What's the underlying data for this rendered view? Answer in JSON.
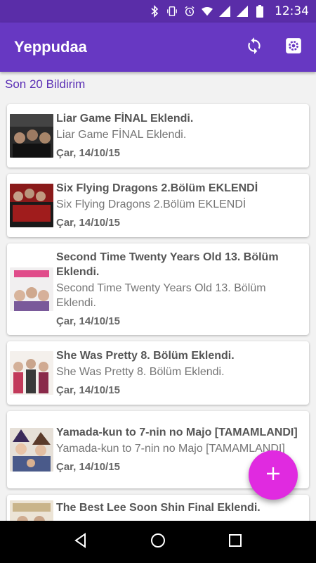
{
  "status_bar": {
    "time": "12:34",
    "icons": [
      "bluetooth-icon",
      "vibrate-icon",
      "alarm-icon",
      "wifi-icon",
      "signal-icon",
      "signal-icon",
      "battery-icon"
    ]
  },
  "app_bar": {
    "title": "Yeppudaa",
    "actions": [
      "refresh-icon",
      "settings-icon"
    ]
  },
  "section_title": "Son 20 Bildirim",
  "notifications": [
    {
      "title": "Liar Game FİNAL Eklendi.",
      "subtitle": "Liar Game FİNAL Eklendi.",
      "date": "Çar, 14/10/15"
    },
    {
      "title": "Six Flying Dragons 2.Bölüm EKLENDİ",
      "subtitle": "Six Flying Dragons 2.Bölüm EKLENDİ",
      "date": "Çar, 14/10/15"
    },
    {
      "title": "Second Time Twenty Years Old 13. Bölüm Eklendi.",
      "subtitle": "Second Time Twenty Years Old 13. Bölüm Eklendi.",
      "date": "Çar, 14/10/15"
    },
    {
      "title": "She Was Pretty 8. Bölüm Eklendi.",
      "subtitle": "She Was Pretty 8. Bölüm Eklendi.",
      "date": "Çar, 14/10/15"
    },
    {
      "title": "Yamada-kun to 7-nin no Majo [TAMAMLANDI]",
      "subtitle": "Yamada-kun to 7-nin no Majo [TAMAMLANDI]",
      "date": "Çar, 14/10/15"
    },
    {
      "title": "The Best Lee Soon Shin Final Eklendi.",
      "subtitle": "",
      "date": ""
    }
  ],
  "fab": {
    "icon": "plus-icon"
  },
  "nav_bar": {
    "buttons": [
      "back-icon",
      "home-icon",
      "recents-icon"
    ]
  },
  "colors": {
    "status_bar": "#5a2da8",
    "app_bar": "#6738c2",
    "section_title": "#5b2fb5",
    "fab": "#e02ae0",
    "background": "#f2f2f2"
  }
}
